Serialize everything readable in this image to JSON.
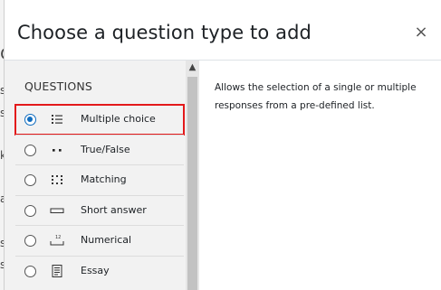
{
  "backdrop": {
    "glyphs": [
      "d",
      "s",
      "s",
      "k",
      "a",
      "s",
      "s"
    ]
  },
  "dialog": {
    "title": "Choose a question type to add",
    "close_label": "×"
  },
  "questions": {
    "heading": "QUESTIONS",
    "items": [
      {
        "label": "Multiple choice",
        "icon": "multiple-choice-icon",
        "selected": true
      },
      {
        "label": "True/False",
        "icon": "true-false-icon",
        "selected": false
      },
      {
        "label": "Matching",
        "icon": "matching-icon",
        "selected": false
      },
      {
        "label": "Short answer",
        "icon": "short-answer-icon",
        "selected": false
      },
      {
        "label": "Numerical",
        "icon": "numerical-icon",
        "selected": false
      },
      {
        "label": "Essay",
        "icon": "essay-icon",
        "selected": false
      }
    ]
  },
  "description": "Allows the selection of a single or multiple responses from a pre-defined list.",
  "colors": {
    "selected_outline": "#e3191b",
    "radio_checked": "#0f6cbf",
    "panel_bg": "#f2f2f2"
  }
}
